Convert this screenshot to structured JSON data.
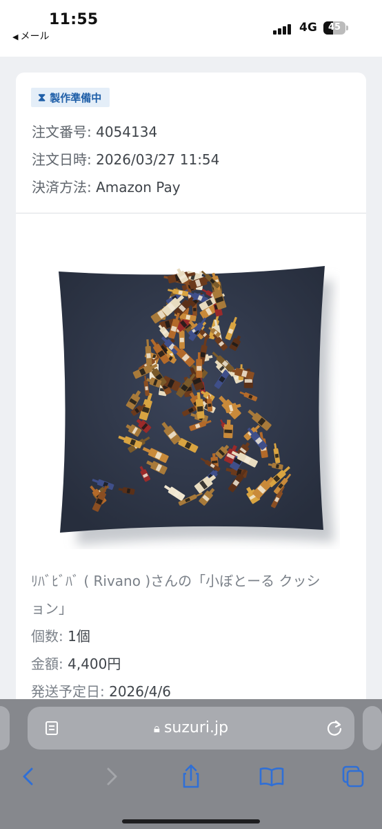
{
  "status_bar": {
    "time": "11:55",
    "back_app": "メール",
    "network": "4G",
    "battery": "45",
    "battery_level": 0.45
  },
  "order": {
    "status_badge": "製作準備中",
    "order_number_label": "注文番号:",
    "order_number": "4054134",
    "order_date_label": "注文日時:",
    "order_date": "2026/03/27 11:54",
    "payment_label": "決済方法:",
    "payment": "Amazon Pay"
  },
  "item": {
    "title_line1": "ﾘﾊﾞﾋﾞﾊﾞ ( Rivano )さんの「小ぼとーる クッシ",
    "title_line2": "ョン」",
    "quantity_label": "個数:",
    "quantity": "1個",
    "price_label": "金額:",
    "price": "4,400円",
    "ship_label": "発送予定日:",
    "ship_date": "2026/4/6"
  },
  "browser": {
    "url": "suzuri.jp",
    "icons": [
      "back-icon",
      "forward-icon",
      "share-icon",
      "bookmarks-icon",
      "tabs-icon",
      "reload-icon",
      "page-menu-icon"
    ]
  },
  "colors": {
    "accent": "#1f5fa8",
    "cushion": "#2c3446",
    "browser_bar": "#86888d"
  }
}
